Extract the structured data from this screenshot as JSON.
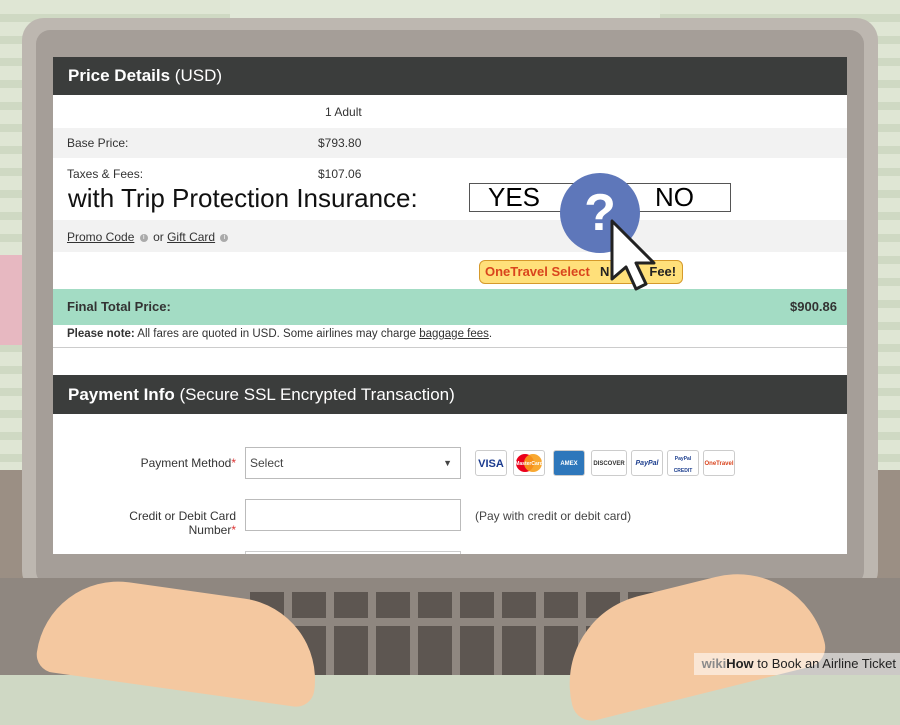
{
  "price_details": {
    "header_title": "Price Details",
    "header_suffix": "(USD)",
    "passenger_label": "1 Adult",
    "base_price_label": "Base Price:",
    "base_price_value": "$793.80",
    "taxes_label": "Taxes & Fees:",
    "taxes_value": "$107.06",
    "trip_protection_text": "with Trip Protection Insurance:",
    "yes_label": "YES",
    "no_label": "NO",
    "question_mark": "?",
    "promo_code_label": "Promo Code",
    "or_text": "or",
    "gift_card_label": "Gift Card",
    "onetravel_brand": "OneTravel Select",
    "onetravel_rest": "N",
    "onetravel_rest2": "Fee!",
    "final_total_label": "Final Total Price:",
    "final_total_value": "$900.86",
    "note_bold": "Please note:",
    "note_text": " All fares are quoted in USD. Some airlines may charge ",
    "baggage_fees_link": "baggage fees",
    "note_end": "."
  },
  "payment_info": {
    "header_title": "Payment Info",
    "header_suffix": "(Secure SSL Encrypted Transaction)",
    "payment_method_label": "Payment Method",
    "required_mark": "*",
    "payment_method_value": "Select",
    "dropdown_arrow": "▼",
    "card_number_label": "Credit or Debit Card Number",
    "card_hint": "(Pay with credit or debit card)",
    "card_logos": [
      "VISA",
      "MasterCard",
      "AMEX",
      "DISCOVER",
      "PayPal",
      "PayPal CREDIT",
      "OneTravel"
    ]
  },
  "watermark": {
    "wiki": "wiki",
    "how": "How",
    "rest": " to Book an Airline Ticket"
  }
}
